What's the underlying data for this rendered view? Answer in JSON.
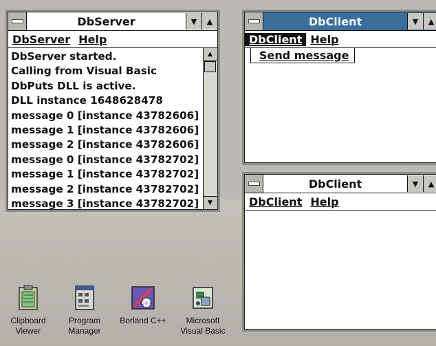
{
  "server_window": {
    "title": "DbServer",
    "menu": [
      "DbServer",
      "Help"
    ],
    "log_lines": [
      "DbServer started.",
      "Calling from Visual Basic",
      "DbPuts DLL is active.",
      "DLL instance 1648628478",
      "message 0 [instance 43782606]",
      "message 1 [instance 43782606]",
      "message 2 [instance 43782606]",
      "message 0 [instance 43782702]",
      "message 1 [instance 43782702]",
      "message 2 [instance 43782702]",
      "message 3 [instance 43782702]"
    ]
  },
  "client_window_1": {
    "title": "DbClient",
    "menu": [
      "DbClient",
      "Help"
    ],
    "open_menu_item": "Send message"
  },
  "client_window_2": {
    "title": "DbClient",
    "menu": [
      "DbClient",
      "Help"
    ]
  },
  "desktop_icons": [
    {
      "label_line1": "Clipboard",
      "label_line2": "Viewer",
      "icon": "clipboard-icon"
    },
    {
      "label_line1": "Program",
      "label_line2": "Manager",
      "icon": "program-manager-icon"
    },
    {
      "label_line1": "Borland C++",
      "label_line2": "",
      "icon": "borland-cpp-icon"
    },
    {
      "label_line1": "Microsoft",
      "label_line2": "Visual Basic",
      "icon": "visual-basic-icon"
    }
  ],
  "colors": {
    "active_title": "#3b6e9b",
    "desktop": "#bdbab5"
  }
}
